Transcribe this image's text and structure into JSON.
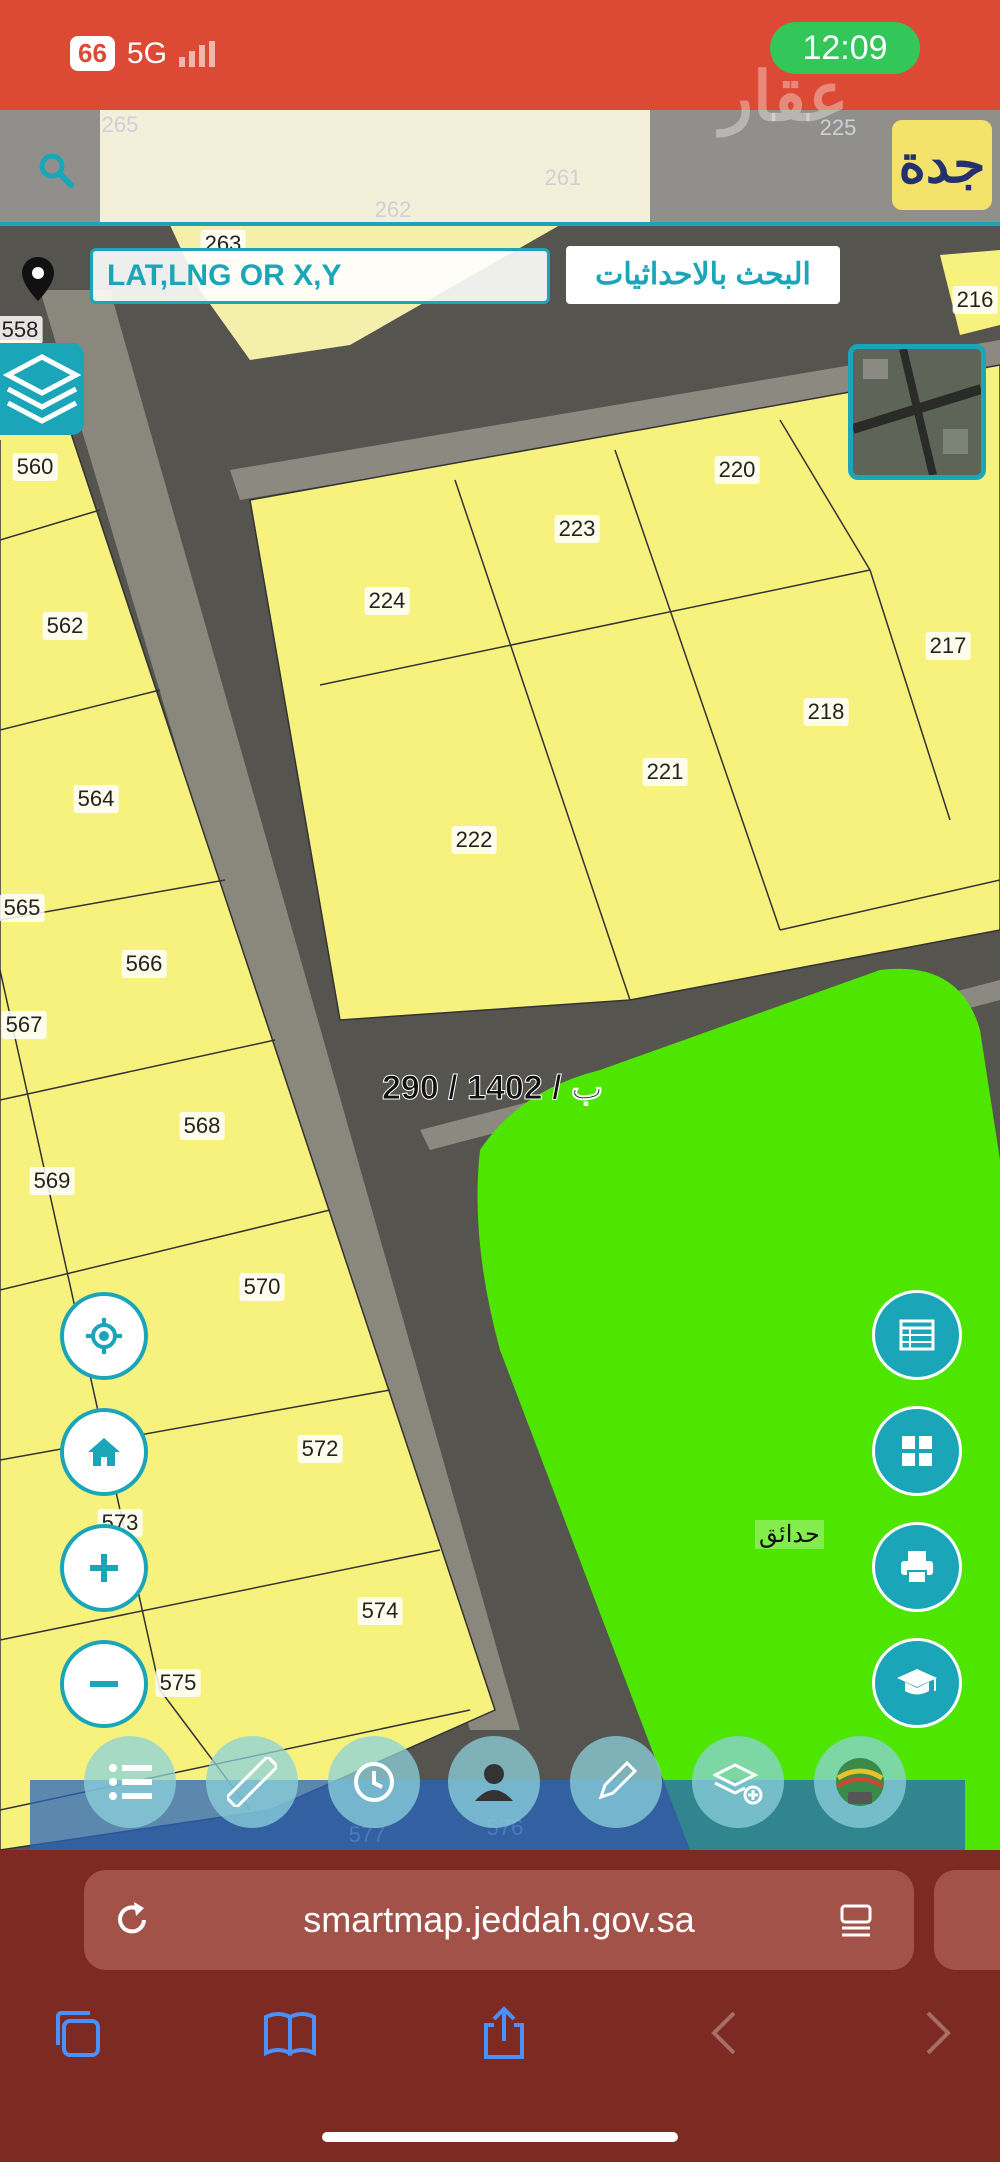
{
  "status": {
    "battery": "66",
    "network": "5G",
    "time": "12:09"
  },
  "header": {
    "watermark": "عقار",
    "logo_text": "جدة"
  },
  "search": {
    "coord_placeholder": "LAT,LNG OR X,Y",
    "coord_button": "البحث بالاحداثيات"
  },
  "lots": [
    {
      "id": "265",
      "faint": true
    },
    {
      "id": "225",
      "faint": true
    },
    {
      "id": "261",
      "faint": true
    },
    {
      "id": "262",
      "faint": true
    },
    {
      "id": "263"
    },
    {
      "id": "216"
    },
    {
      "id": "558"
    },
    {
      "id": "560"
    },
    {
      "id": "220"
    },
    {
      "id": "223"
    },
    {
      "id": "224"
    },
    {
      "id": "217"
    },
    {
      "id": "562"
    },
    {
      "id": "218"
    },
    {
      "id": "221"
    },
    {
      "id": "564"
    },
    {
      "id": "222"
    },
    {
      "id": "565"
    },
    {
      "id": "566"
    },
    {
      "id": "567"
    },
    {
      "id": "568"
    },
    {
      "id": "569"
    },
    {
      "id": "570"
    },
    {
      "id": "572"
    },
    {
      "id": "573"
    },
    {
      "id": "574"
    },
    {
      "id": "575"
    },
    {
      "id": "577",
      "faint": true
    },
    {
      "id": "576",
      "faint": true
    }
  ],
  "parcel_label": "ب / 1402 / 290",
  "park_label": "حدائق",
  "browser": {
    "url": "smartmap.jeddah.gov.sa"
  },
  "colors": {
    "status_bar": "#dc4a36",
    "accent": "#1aa6b8",
    "parcel_yellow": "#f7f27e",
    "park_green": "#4ee600",
    "browser_bg": "#7d2b22"
  }
}
